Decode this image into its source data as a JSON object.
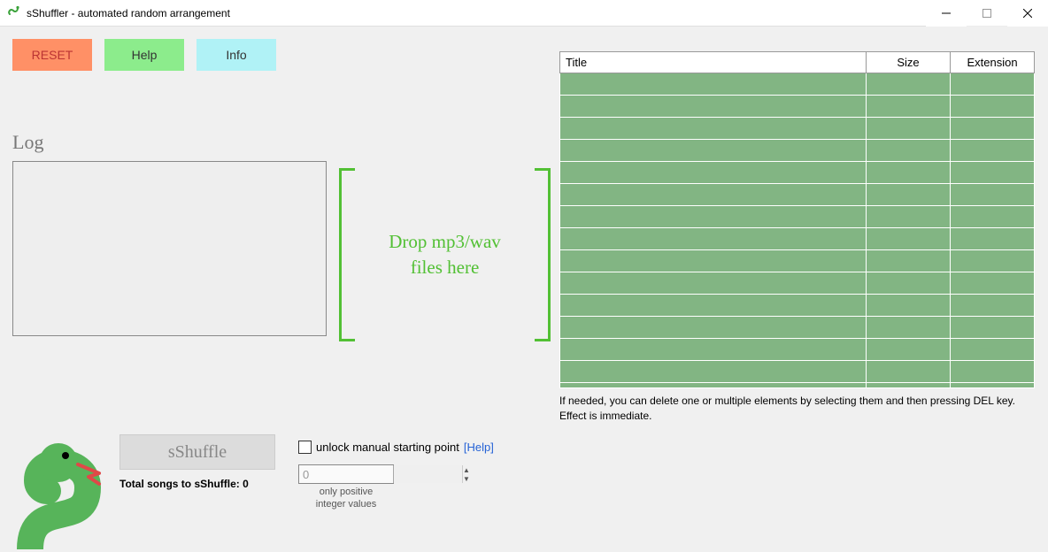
{
  "window": {
    "title": "sShuffler - automated random arrangement"
  },
  "buttons": {
    "reset": "RESET",
    "help": "Help",
    "info": "Info"
  },
  "log": {
    "label": "Log"
  },
  "dropzone": {
    "line1": "Drop mp3/wav",
    "line2": "files here"
  },
  "shuffle": {
    "label": "sShuffle",
    "total_label": "Total songs to sShuffle: 0"
  },
  "options": {
    "checkbox_label": "unlock manual starting point",
    "help_link": "[Help]",
    "stepper_value": "0",
    "hint_line1": "only positive",
    "hint_line2": "integer values"
  },
  "table": {
    "headers": {
      "title": "Title",
      "size": "Size",
      "ext": "Extension"
    },
    "note": "If needed, you can delete one or multiple elements by selecting them and then pressing DEL key. Effect is immediate."
  }
}
